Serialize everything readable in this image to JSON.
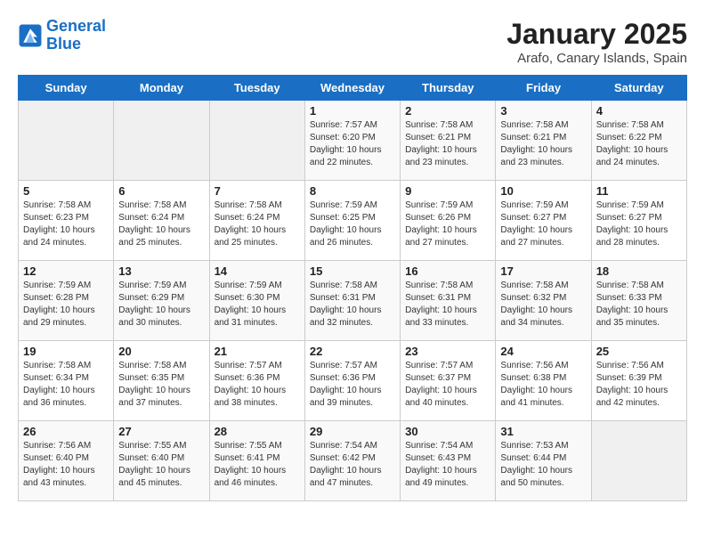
{
  "logo": {
    "line1": "General",
    "line2": "Blue"
  },
  "title": "January 2025",
  "subtitle": "Arafo, Canary Islands, Spain",
  "days_of_week": [
    "Sunday",
    "Monday",
    "Tuesday",
    "Wednesday",
    "Thursday",
    "Friday",
    "Saturday"
  ],
  "weeks": [
    [
      {
        "day": "",
        "sunrise": "",
        "sunset": "",
        "daylight": ""
      },
      {
        "day": "",
        "sunrise": "",
        "sunset": "",
        "daylight": ""
      },
      {
        "day": "",
        "sunrise": "",
        "sunset": "",
        "daylight": ""
      },
      {
        "day": "1",
        "sunrise": "Sunrise: 7:57 AM",
        "sunset": "Sunset: 6:20 PM",
        "daylight": "Daylight: 10 hours and 22 minutes."
      },
      {
        "day": "2",
        "sunrise": "Sunrise: 7:58 AM",
        "sunset": "Sunset: 6:21 PM",
        "daylight": "Daylight: 10 hours and 23 minutes."
      },
      {
        "day": "3",
        "sunrise": "Sunrise: 7:58 AM",
        "sunset": "Sunset: 6:21 PM",
        "daylight": "Daylight: 10 hours and 23 minutes."
      },
      {
        "day": "4",
        "sunrise": "Sunrise: 7:58 AM",
        "sunset": "Sunset: 6:22 PM",
        "daylight": "Daylight: 10 hours and 24 minutes."
      }
    ],
    [
      {
        "day": "5",
        "sunrise": "Sunrise: 7:58 AM",
        "sunset": "Sunset: 6:23 PM",
        "daylight": "Daylight: 10 hours and 24 minutes."
      },
      {
        "day": "6",
        "sunrise": "Sunrise: 7:58 AM",
        "sunset": "Sunset: 6:24 PM",
        "daylight": "Daylight: 10 hours and 25 minutes."
      },
      {
        "day": "7",
        "sunrise": "Sunrise: 7:58 AM",
        "sunset": "Sunset: 6:24 PM",
        "daylight": "Daylight: 10 hours and 25 minutes."
      },
      {
        "day": "8",
        "sunrise": "Sunrise: 7:59 AM",
        "sunset": "Sunset: 6:25 PM",
        "daylight": "Daylight: 10 hours and 26 minutes."
      },
      {
        "day": "9",
        "sunrise": "Sunrise: 7:59 AM",
        "sunset": "Sunset: 6:26 PM",
        "daylight": "Daylight: 10 hours and 27 minutes."
      },
      {
        "day": "10",
        "sunrise": "Sunrise: 7:59 AM",
        "sunset": "Sunset: 6:27 PM",
        "daylight": "Daylight: 10 hours and 27 minutes."
      },
      {
        "day": "11",
        "sunrise": "Sunrise: 7:59 AM",
        "sunset": "Sunset: 6:27 PM",
        "daylight": "Daylight: 10 hours and 28 minutes."
      }
    ],
    [
      {
        "day": "12",
        "sunrise": "Sunrise: 7:59 AM",
        "sunset": "Sunset: 6:28 PM",
        "daylight": "Daylight: 10 hours and 29 minutes."
      },
      {
        "day": "13",
        "sunrise": "Sunrise: 7:59 AM",
        "sunset": "Sunset: 6:29 PM",
        "daylight": "Daylight: 10 hours and 30 minutes."
      },
      {
        "day": "14",
        "sunrise": "Sunrise: 7:59 AM",
        "sunset": "Sunset: 6:30 PM",
        "daylight": "Daylight: 10 hours and 31 minutes."
      },
      {
        "day": "15",
        "sunrise": "Sunrise: 7:58 AM",
        "sunset": "Sunset: 6:31 PM",
        "daylight": "Daylight: 10 hours and 32 minutes."
      },
      {
        "day": "16",
        "sunrise": "Sunrise: 7:58 AM",
        "sunset": "Sunset: 6:31 PM",
        "daylight": "Daylight: 10 hours and 33 minutes."
      },
      {
        "day": "17",
        "sunrise": "Sunrise: 7:58 AM",
        "sunset": "Sunset: 6:32 PM",
        "daylight": "Daylight: 10 hours and 34 minutes."
      },
      {
        "day": "18",
        "sunrise": "Sunrise: 7:58 AM",
        "sunset": "Sunset: 6:33 PM",
        "daylight": "Daylight: 10 hours and 35 minutes."
      }
    ],
    [
      {
        "day": "19",
        "sunrise": "Sunrise: 7:58 AM",
        "sunset": "Sunset: 6:34 PM",
        "daylight": "Daylight: 10 hours and 36 minutes."
      },
      {
        "day": "20",
        "sunrise": "Sunrise: 7:58 AM",
        "sunset": "Sunset: 6:35 PM",
        "daylight": "Daylight: 10 hours and 37 minutes."
      },
      {
        "day": "21",
        "sunrise": "Sunrise: 7:57 AM",
        "sunset": "Sunset: 6:36 PM",
        "daylight": "Daylight: 10 hours and 38 minutes."
      },
      {
        "day": "22",
        "sunrise": "Sunrise: 7:57 AM",
        "sunset": "Sunset: 6:36 PM",
        "daylight": "Daylight: 10 hours and 39 minutes."
      },
      {
        "day": "23",
        "sunrise": "Sunrise: 7:57 AM",
        "sunset": "Sunset: 6:37 PM",
        "daylight": "Daylight: 10 hours and 40 minutes."
      },
      {
        "day": "24",
        "sunrise": "Sunrise: 7:56 AM",
        "sunset": "Sunset: 6:38 PM",
        "daylight": "Daylight: 10 hours and 41 minutes."
      },
      {
        "day": "25",
        "sunrise": "Sunrise: 7:56 AM",
        "sunset": "Sunset: 6:39 PM",
        "daylight": "Daylight: 10 hours and 42 minutes."
      }
    ],
    [
      {
        "day": "26",
        "sunrise": "Sunrise: 7:56 AM",
        "sunset": "Sunset: 6:40 PM",
        "daylight": "Daylight: 10 hours and 43 minutes."
      },
      {
        "day": "27",
        "sunrise": "Sunrise: 7:55 AM",
        "sunset": "Sunset: 6:40 PM",
        "daylight": "Daylight: 10 hours and 45 minutes."
      },
      {
        "day": "28",
        "sunrise": "Sunrise: 7:55 AM",
        "sunset": "Sunset: 6:41 PM",
        "daylight": "Daylight: 10 hours and 46 minutes."
      },
      {
        "day": "29",
        "sunrise": "Sunrise: 7:54 AM",
        "sunset": "Sunset: 6:42 PM",
        "daylight": "Daylight: 10 hours and 47 minutes."
      },
      {
        "day": "30",
        "sunrise": "Sunrise: 7:54 AM",
        "sunset": "Sunset: 6:43 PM",
        "daylight": "Daylight: 10 hours and 49 minutes."
      },
      {
        "day": "31",
        "sunrise": "Sunrise: 7:53 AM",
        "sunset": "Sunset: 6:44 PM",
        "daylight": "Daylight: 10 hours and 50 minutes."
      },
      {
        "day": "",
        "sunrise": "",
        "sunset": "",
        "daylight": ""
      }
    ]
  ]
}
